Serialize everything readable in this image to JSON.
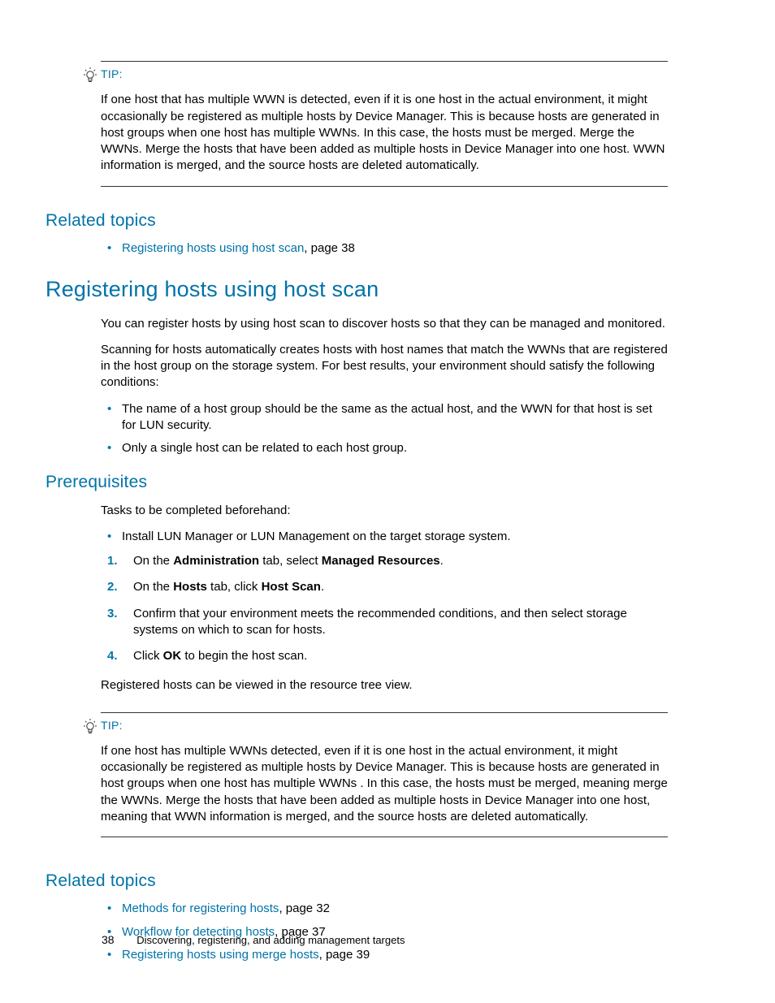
{
  "tip1": {
    "label": "TIP:",
    "body": "If one host that has multiple WWN is detected, even if it is one host in the actual environment, it might occasionally be registered as multiple hosts by Device Manager. This is because hosts are generated in host groups when one host has multiple WWNs. In this case, the hosts must be merged. Merge the WWNs. Merge the hosts that have been added as multiple hosts in Device Manager into one host. WWN information is merged, and the source hosts are deleted automatically."
  },
  "related1": {
    "heading": "Related topics",
    "item": {
      "link": "Registering hosts using host scan",
      "suffix": ", page 38"
    }
  },
  "section": {
    "heading": "Registering hosts using host scan",
    "p1": "You can register hosts by using host scan to discover hosts so that they can be managed and monitored.",
    "p2": "Scanning for hosts automatically creates hosts with host names that match the WWNs that are registered in the host group on the storage system. For best results, your environment should satisfy the following conditions:",
    "b1": "The name of a host group should be the same as the actual host, and the WWN for that host is set for LUN security.",
    "b2": "Only a single host can be related to each host group."
  },
  "prereq": {
    "heading": "Prerequisites",
    "intro": "Tasks to be completed beforehand:",
    "b1": "Install LUN Manager or LUN Management on the target storage system.",
    "s1a": "On the ",
    "s1b": "Administration",
    "s1c": " tab, select ",
    "s1d": "Managed Resources",
    "s1e": ".",
    "s2a": "On the ",
    "s2b": "Hosts",
    "s2c": " tab, click ",
    "s2d": "Host Scan",
    "s2e": ".",
    "s3": "Confirm that your environment meets the recommended conditions, and then select storage systems on which to scan for hosts.",
    "s4a": "Click ",
    "s4b": "OK",
    "s4c": " to begin the host scan.",
    "after": "Registered hosts can be viewed in the resource tree view."
  },
  "tip2": {
    "label": "TIP:",
    "body": "If one host has multiple WWNs detected, even if it is one host in the actual environment, it might occasionally be registered as multiple hosts by Device Manager. This is because hosts are generated in host groups when one host has multiple WWNs . In this case, the hosts must be merged, meaning merge the WWNs. Merge the hosts that have been added as multiple hosts in Device Manager into one host, meaning that WWN information is merged, and the source hosts are deleted automatically."
  },
  "related2": {
    "heading": "Related topics",
    "i1": {
      "link": "Methods for registering hosts",
      "suffix": ", page 32"
    },
    "i2": {
      "link": "Workflow for detecting hosts",
      "suffix": ", page 37"
    },
    "i3": {
      "link": "Registering hosts using merge hosts",
      "suffix": ", page 39"
    }
  },
  "footer": {
    "page": "38",
    "title": "Discovering, registering, and adding management targets"
  }
}
